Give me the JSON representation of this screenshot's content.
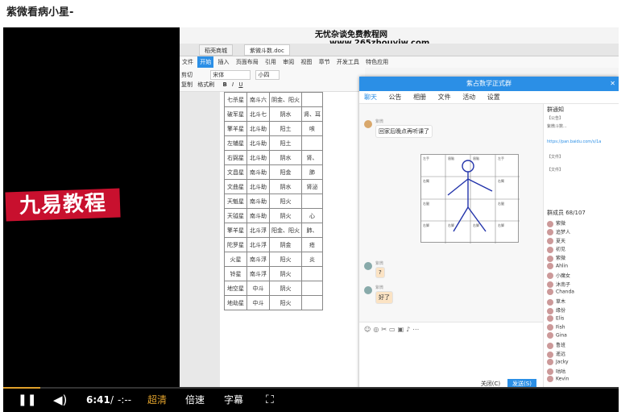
{
  "page_title": "紫微看病小星-",
  "overlay_logo": "九易教程",
  "watermark": {
    "line1": "无忧杂谈免费教程网",
    "url": "www.265zhouyiw.com"
  },
  "doc_tabs": [
    "稻壳商城",
    "紫微斗数.doc"
  ],
  "menu": [
    "文件",
    "开始",
    "插入",
    "页面布局",
    "引用",
    "审阅",
    "视图",
    "章节",
    "开发工具",
    "特色应用"
  ],
  "toolbar": {
    "cut": "剪切",
    "copy": "复制",
    "format_painter": "格式刷",
    "font": "宋体",
    "font_size": "小四"
  },
  "doc_table": [
    [
      "七杀星",
      "南斗六",
      "阴金、阳火",
      ""
    ],
    [
      "破军星",
      "北斗七",
      "阴水",
      "肾、耳"
    ],
    [
      "擎羊星",
      "北斗助",
      "阳土",
      "咳"
    ],
    [
      "左辅星",
      "北斗助",
      "阳土",
      ""
    ],
    [
      "右弼星",
      "北斗助",
      "阴水",
      "肾、"
    ],
    [
      "文昌星",
      "南斗助",
      "阳金",
      "肺"
    ],
    [
      "文曲星",
      "北斗助",
      "阴水",
      "肾泌"
    ],
    [
      "天魁星",
      "南斗助",
      "阳火",
      ""
    ],
    [
      "天钺星",
      "南斗助",
      "阴火",
      "心"
    ],
    [
      "擎羊星",
      "北斗浮",
      "阳金、阳火",
      "肺、"
    ],
    [
      "陀罗星",
      "北斗浮",
      "阴金",
      "疮"
    ],
    [
      "火星",
      "南斗浮",
      "阳火",
      "炎"
    ],
    [
      "铃星",
      "南斗浮",
      "阴火",
      ""
    ],
    [
      "地空星",
      "中斗",
      "阴火",
      ""
    ],
    [
      "地劫星",
      "中斗",
      "阳火",
      ""
    ]
  ],
  "chat": {
    "title": "紫占数学正式群",
    "tabs": [
      "聊天",
      "公告",
      "相册",
      "文件",
      "活动",
      "设置"
    ],
    "messages": [
      {
        "sender": "紫微",
        "text": "回家后晚点再听课了"
      },
      {
        "sender": "紫微",
        "text": "?"
      },
      {
        "sender": "紫微",
        "text": "好了"
      }
    ],
    "diagram_labels": [
      "左手",
      "眉脑",
      "眉脑",
      "左手",
      "右臂",
      "右臂",
      "右腿",
      "右腿",
      "右脚",
      "右脚",
      "右脚",
      "右脚"
    ],
    "close_label": "关闭(C)",
    "send_label": "发送(S)"
  },
  "notice": {
    "title": "群通知",
    "lines": [
      "【公告】",
      "紫微斗数...",
      "https://pan.baidu.com/s/1a",
      "【文件】",
      "【文件】"
    ]
  },
  "members": {
    "title": "群成员 68/107",
    "items": [
      "紫微",
      "追梦人",
      "夏天",
      "初见",
      "紫微",
      "Ahlin",
      "小魔女",
      "沐南子",
      "Chanda",
      "草木",
      "缘份",
      "Elis",
      "Fish",
      "Gina",
      "鲁班",
      "遥远",
      "Jacky",
      "咕咕",
      "Kevin"
    ]
  },
  "player": {
    "time": "6:41",
    "separator": "/",
    "duration": "-:--",
    "quality": "超清",
    "speed": "倍速",
    "subtitle": "字幕",
    "progress": 0.06,
    "accent": "#e0a12b"
  }
}
